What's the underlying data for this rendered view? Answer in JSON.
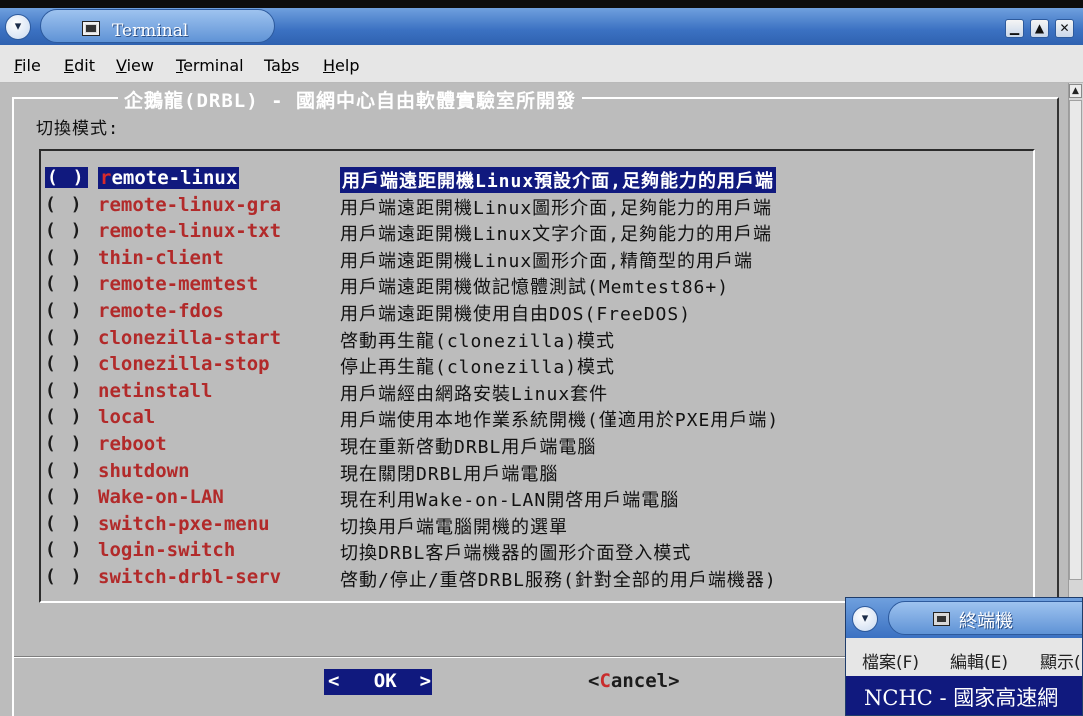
{
  "window": {
    "title": "Terminal",
    "menu_icon": "chevron-down-icon",
    "controls": [
      "minimize-icon",
      "maximize-icon",
      "close-icon"
    ]
  },
  "menubar": {
    "items": [
      {
        "label": "File",
        "mnemonic": "F"
      },
      {
        "label": "Edit",
        "mnemonic": "E"
      },
      {
        "label": "View",
        "mnemonic": "V"
      },
      {
        "label": "Terminal",
        "mnemonic": "T"
      },
      {
        "label": "Tabs",
        "mnemonic": "b"
      },
      {
        "label": "Help",
        "mnemonic": "H"
      }
    ]
  },
  "dialog": {
    "title": "企鵝龍(DRBL) - 國網中心自由軟體實驗室所開發",
    "prompt": "切換模式:",
    "selected_index": 0,
    "items": [
      {
        "radio": "( )",
        "tag": "remote-linux",
        "desc": "用戶端遠距開機Linux預設介面,足夠能力的用戶端"
      },
      {
        "radio": "( )",
        "tag": "remote-linux-gra",
        "desc": "用戶端遠距開機Linux圖形介面,足夠能力的用戶端"
      },
      {
        "radio": "( )",
        "tag": "remote-linux-txt",
        "desc": "用戶端遠距開機Linux文字介面,足夠能力的用戶端"
      },
      {
        "radio": "( )",
        "tag": "thin-client",
        "desc": "用戶端遠距開機Linux圖形介面,精簡型的用戶端"
      },
      {
        "radio": "( )",
        "tag": "remote-memtest",
        "desc": "用戶端遠距開機做記憶體測試(Memtest86+)"
      },
      {
        "radio": "( )",
        "tag": "remote-fdos",
        "desc": "用戶端遠距開機使用自由DOS(FreeDOS)"
      },
      {
        "radio": "( )",
        "tag": "clonezilla-start",
        "desc": "啓動再生龍(clonezilla)模式"
      },
      {
        "radio": "( )",
        "tag": "clonezilla-stop",
        "desc": "停止再生龍(clonezilla)模式"
      },
      {
        "radio": "( )",
        "tag": "netinstall",
        "desc": "用戶端經由網路安裝Linux套件"
      },
      {
        "radio": "( )",
        "tag": "local",
        "desc": "用戶端使用本地作業系統開機(僅適用於PXE用戶端)"
      },
      {
        "radio": "( )",
        "tag": "reboot",
        "desc": "現在重新啓動DRBL用戶端電腦"
      },
      {
        "radio": "( )",
        "tag": "shutdown",
        "desc": "現在關閉DRBL用戶端電腦"
      },
      {
        "radio": "( )",
        "tag": "Wake-on-LAN",
        "desc": "現在利用Wake-on-LAN開啓用戶端電腦"
      },
      {
        "radio": "( )",
        "tag": "switch-pxe-menu",
        "desc": "切換用戶端電腦開機的選單"
      },
      {
        "radio": "( )",
        "tag": "login-switch",
        "desc": "切換DRBL客戶端機器的圖形介面登入模式"
      },
      {
        "radio": "( )",
        "tag": "switch-drbl-serv",
        "desc": "啓動/停止/重啓DRBL服務(針對全部的用戶端機器)"
      }
    ],
    "buttons": {
      "ok": {
        "left": "<",
        "hot": "O",
        "rest": "K",
        "right": ">"
      },
      "cancel": {
        "left": "<",
        "hot": "C",
        "rest": "ancel",
        "right": ">"
      }
    }
  },
  "window2": {
    "title": "終端機",
    "menu_items": [
      "檔案(F)",
      "編輯(E)",
      "顯示("
    ],
    "banner": "NCHC - 國家高速網"
  },
  "colors": {
    "selection_bg": "#10197e",
    "tag_red": "#b22a2a",
    "dialog_bg": "#bcbcbc",
    "titlebar_blue": "#3b71c2"
  }
}
